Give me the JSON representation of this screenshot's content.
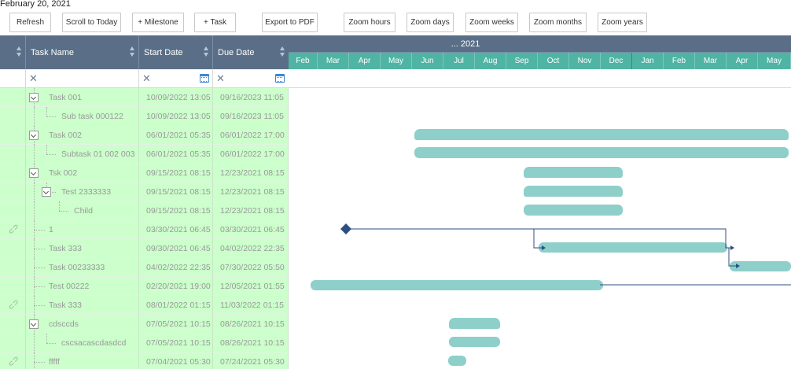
{
  "page_date": "February 20, 2021",
  "toolbar": {
    "buttons": [
      {
        "name": "refresh-button",
        "label": "Refresh"
      },
      {
        "name": "scroll-to-today-button",
        "label": "Scroll to Today"
      },
      {
        "name": "add-milestone-button",
        "label": "+ Milestone"
      },
      {
        "name": "add-task-button",
        "label": "+ Task"
      },
      {
        "name": "export-pdf-button",
        "label": "Export to PDF"
      },
      {
        "name": "zoom-hours-button",
        "label": "Zoom hours"
      },
      {
        "name": "zoom-days-button",
        "label": "Zoom days"
      },
      {
        "name": "zoom-weeks-button",
        "label": "Zoom weeks"
      },
      {
        "name": "zoom-months-button",
        "label": "Zoom months"
      },
      {
        "name": "zoom-years-button",
        "label": "Zoom years"
      }
    ]
  },
  "grid": {
    "columns": {
      "name": "Task Name",
      "start": "Start Date",
      "due": "Due Date"
    },
    "rows": [
      {
        "name": "Task 001",
        "start": "10/09/2022 13:05",
        "due": "09/16/2023 11:05",
        "level": 0,
        "expander": true,
        "attachment": false
      },
      {
        "name": "Sub task 000122",
        "start": "10/09/2022 13:05",
        "due": "09/16/2023 11:05",
        "level": 1,
        "expander": false,
        "attachment": false
      },
      {
        "name": "Task 002",
        "start": "06/01/2021 05:35",
        "due": "06/01/2022 17:00",
        "level": 0,
        "expander": true,
        "attachment": false
      },
      {
        "name": "Subtask 01 002 003",
        "start": "06/01/2021 05:35",
        "due": "06/01/2022 17:00",
        "level": 1,
        "expander": false,
        "attachment": false
      },
      {
        "name": "Tsk 002",
        "start": "09/15/2021 08:15",
        "due": "12/23/2021 08:15",
        "level": 0,
        "expander": true,
        "attachment": false
      },
      {
        "name": "Test 2333333",
        "start": "09/15/2021 08:15",
        "due": "12/23/2021 08:15",
        "level": 1,
        "expander": true,
        "attachment": false
      },
      {
        "name": "Child",
        "start": "09/15/2021 08:15",
        "due": "12/23/2021 08:15",
        "level": 2,
        "expander": false,
        "attachment": false
      },
      {
        "name": "1",
        "start": "03/30/2021 06:45",
        "due": "03/30/2021 06:45",
        "level": 0,
        "expander": false,
        "attachment": true
      },
      {
        "name": "Task 333",
        "start": "09/30/2021 06:45",
        "due": "04/02/2022 22:35",
        "level": 0,
        "expander": false,
        "attachment": false
      },
      {
        "name": "Task 00233333",
        "start": "04/02/2022 22:35",
        "due": "07/30/2022 05:50",
        "level": 0,
        "expander": false,
        "attachment": false
      },
      {
        "name": "Test 00222",
        "start": "02/20/2021 19:00",
        "due": "12/05/2021 01:55",
        "level": 0,
        "expander": false,
        "attachment": false
      },
      {
        "name": "Task 333",
        "start": "08/01/2022 01:15",
        "due": "11/03/2022 01:15",
        "level": 0,
        "expander": false,
        "attachment": true
      },
      {
        "name": "cdsccds",
        "start": "07/05/2021 10:15",
        "due": "08/26/2021 10:15",
        "level": 0,
        "expander": true,
        "attachment": false
      },
      {
        "name": "cscsacascdasdcd",
        "start": "07/05/2021 10:15",
        "due": "08/26/2021 10:15",
        "level": 1,
        "expander": false,
        "attachment": false
      },
      {
        "name": "fffff",
        "start": "07/04/2021 05:30",
        "due": "07/24/2021 05:30",
        "level": 0,
        "expander": false,
        "attachment": true
      }
    ]
  },
  "timeline": {
    "year_label": "... 2021",
    "months": [
      "Feb",
      "Mar",
      "Apr",
      "May",
      "Jun",
      "Jul",
      "Aug",
      "Sep",
      "Oct",
      "Nov",
      "Dec",
      "Jan",
      "Feb",
      "Mar",
      "Apr",
      "May"
    ],
    "bar_color": "#8ecfca",
    "header_color": "#5a6f87",
    "month_color": "#4fb4a4",
    "row_color": "#ccffcc"
  }
}
